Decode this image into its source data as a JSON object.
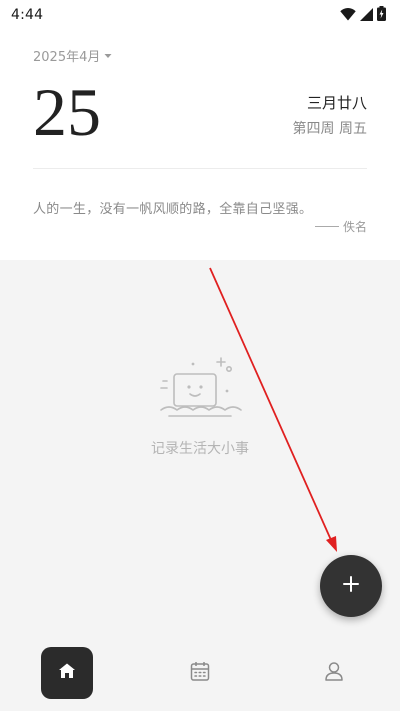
{
  "status_bar": {
    "time": "4:44",
    "icons": [
      "wifi-icon",
      "cellular-signal-icon",
      "battery-icon"
    ]
  },
  "header": {
    "month_label": "2025年4月",
    "day": "25",
    "lunar_date": "三月廿八",
    "week_info": "第四周 周五"
  },
  "quote": {
    "text": "人的一生，没有一帆风顺的路，全靠自己坚强。",
    "author": "佚名"
  },
  "empty_state": {
    "text": "记录生活大小事",
    "icon": "empty-box-illustration"
  },
  "fab": {
    "icon": "plus-icon"
  },
  "bottom_nav": {
    "items": [
      {
        "id": "home",
        "icon": "home-icon",
        "active": true
      },
      {
        "id": "calendar",
        "icon": "calendar-icon",
        "active": false
      },
      {
        "id": "profile",
        "icon": "user-icon",
        "active": false
      }
    ]
  },
  "colors": {
    "fab_background": "#333333",
    "active_nav_background": "#2b2b2b",
    "content_background": "#f4f4f4",
    "annotation_arrow": "#e02020"
  }
}
